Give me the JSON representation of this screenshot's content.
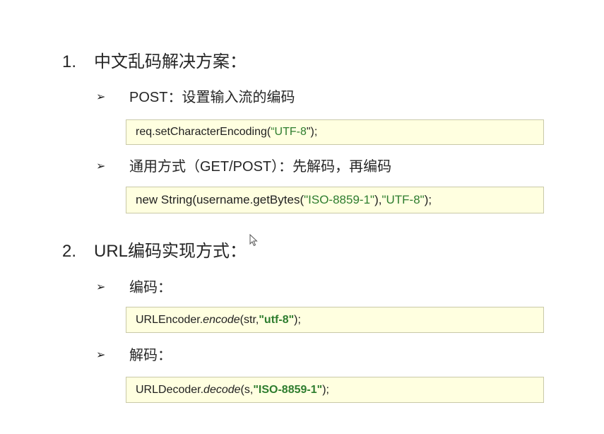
{
  "section1": {
    "number": "1.",
    "title": "中文乱码解决方案："
  },
  "bullet_post": {
    "arrow": "➢",
    "label": "POST：设置输入流的编码"
  },
  "code_post": {
    "prefix": "req.setCharacterEncoding(",
    "string": "“UTF-8",
    "suffix": "\");"
  },
  "bullet_general": {
    "arrow": "➢",
    "label": "通用方式（GET/POST）：先解码，再编码"
  },
  "code_general": {
    "prefix": "new String(username.getBytes(",
    "string1": "\"ISO-8859-1\"",
    "mid": "),",
    "string2": "\"UTF-8\"",
    "suffix": ");"
  },
  "section2": {
    "number": "2.",
    "title": "URL编码实现方式："
  },
  "bullet_encode": {
    "arrow": "➢",
    "label": "编码："
  },
  "code_encode": {
    "prefix": "URLEncoder.",
    "method": "encode",
    "args": "(str, ",
    "string": "\"utf-8\"",
    "suffix": ");"
  },
  "bullet_decode": {
    "arrow": "➢",
    "label": "解码："
  },
  "code_decode": {
    "prefix": "URLDecoder.",
    "method": "decode",
    "args": "(s, ",
    "string": "\"ISO-8859-1\"",
    "suffix": ");"
  },
  "colors": {
    "string_green": "#2e7d2e",
    "code_bg": "#ffffe0"
  }
}
